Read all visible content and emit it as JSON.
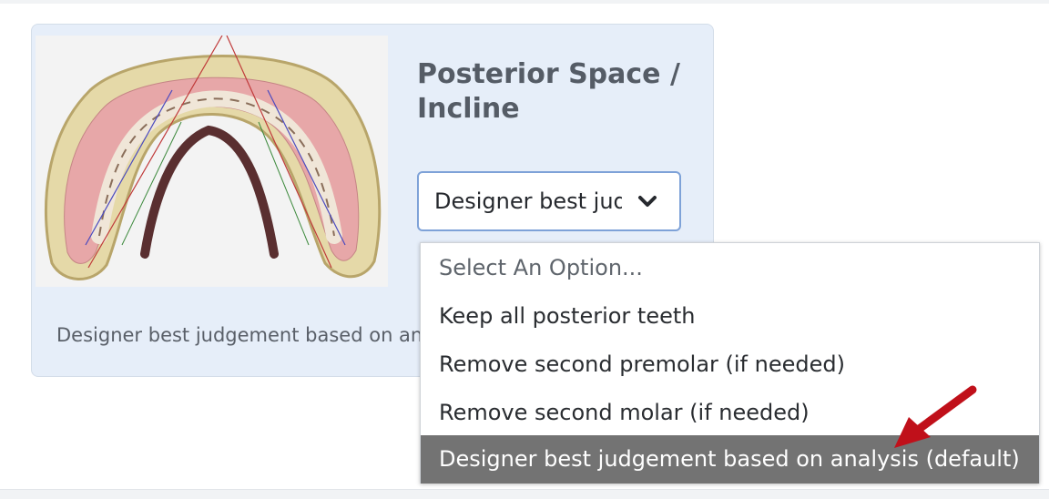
{
  "card": {
    "title": "Posterior Space / Incline",
    "description": "Designer best judgement based on analysis (default)",
    "image_alt": "dental-arch-render"
  },
  "select": {
    "value": "Designer best judgement based on analysis (default)",
    "icon": "chevron-down-icon"
  },
  "dropdown": {
    "options": [
      {
        "label": "Select An Option...",
        "placeholder": true
      },
      {
        "label": "Keep all posterior teeth"
      },
      {
        "label": "Remove second premolar (if needed)"
      },
      {
        "label": "Remove second molar (if needed)"
      },
      {
        "label": "Designer best judgement based on analysis (default)",
        "selected": true
      }
    ]
  },
  "annotation": {
    "icon": "red-arrow-icon",
    "color": "#c0101a"
  },
  "colors": {
    "card_bg": "#e6eef9",
    "select_border": "#7ea2d8",
    "selected_option_bg": "#737373",
    "title": "#555c66"
  }
}
